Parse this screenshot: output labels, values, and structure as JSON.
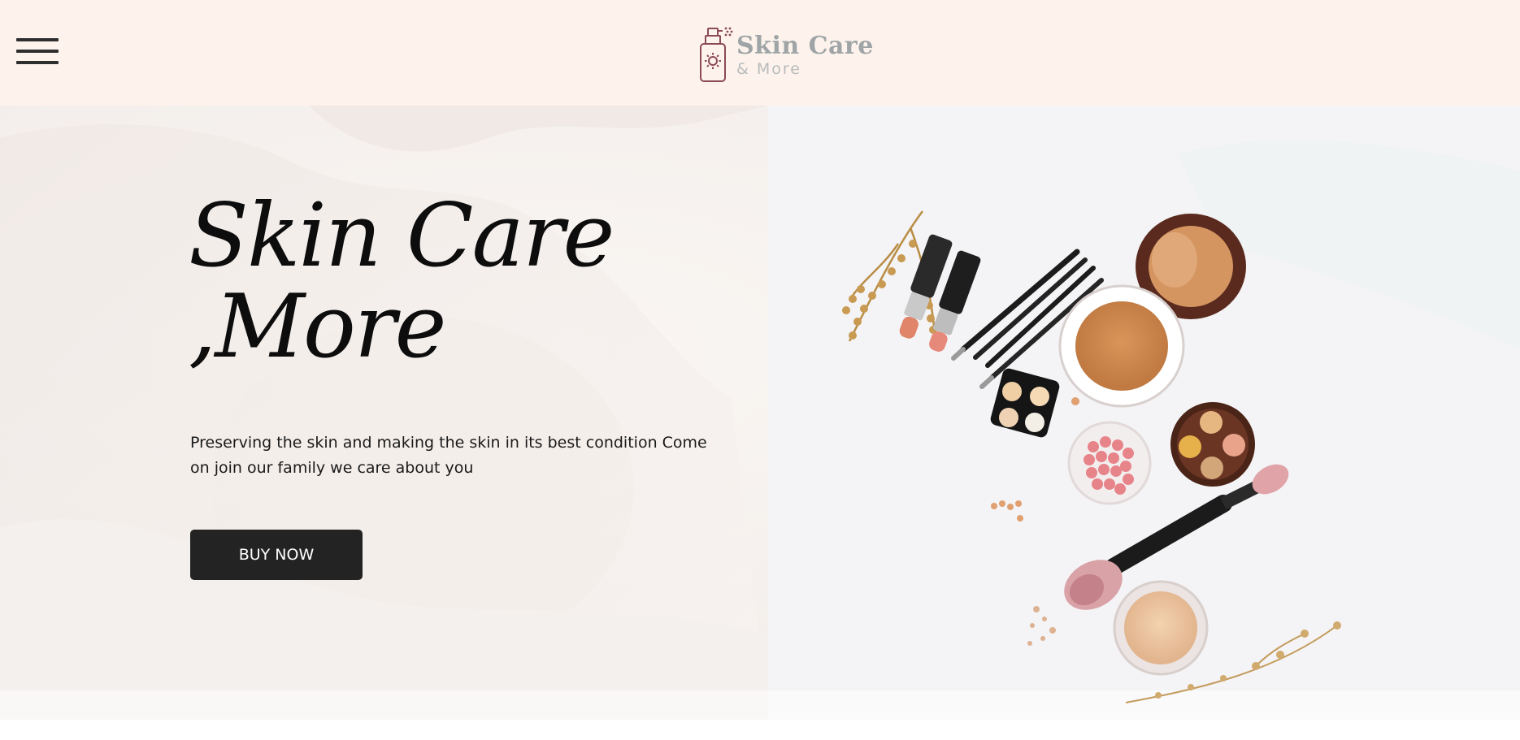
{
  "header": {
    "menu_icon": "hamburger-menu-icon",
    "logo": {
      "icon": "spray-bottle-icon",
      "title": "Skin Care",
      "subtitle": "& More"
    },
    "background_color": "#fdf3ec"
  },
  "hero": {
    "title_line1": "Skin Care",
    "title_line2": ",More",
    "description": "Preserving the skin and making the skin in its best condition Come on join our family we care about you",
    "cta_label": "BUY NOW",
    "cta_color": "#232323"
  }
}
